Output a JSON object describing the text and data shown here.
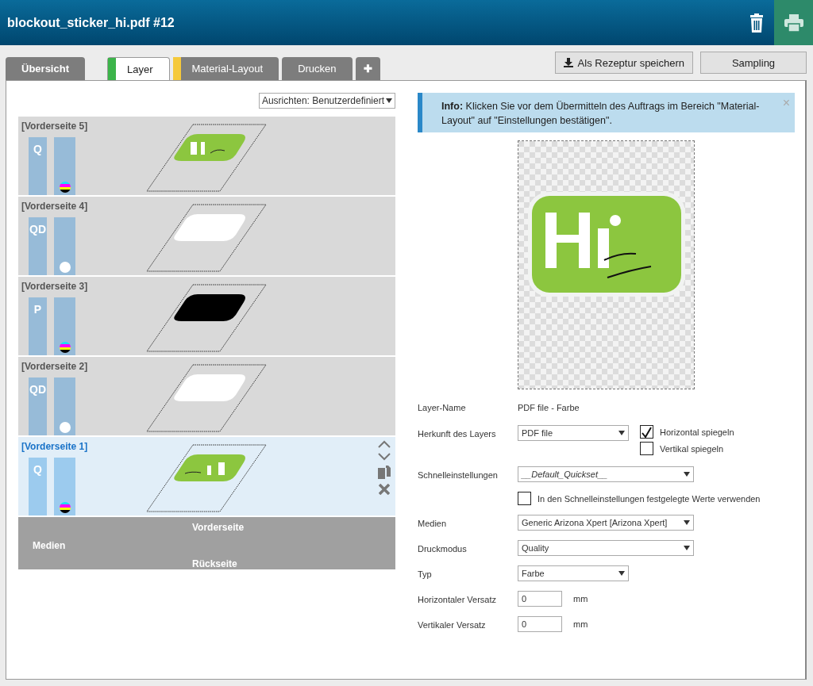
{
  "header": {
    "title": "blockout_sticker_hi.pdf #12"
  },
  "tabs": [
    {
      "label": "Übersicht",
      "selected": false
    },
    {
      "label": "Layer",
      "selected": true,
      "color": "#3cb44a"
    },
    {
      "label": "Material-Layout",
      "selected": false,
      "color": "#f5c93b"
    },
    {
      "label": "Drucken",
      "selected": false
    },
    {
      "label": "✚",
      "selected": false
    }
  ],
  "actions": [
    "Als Rezeptur speichern",
    "Sampling"
  ],
  "align_select": {
    "value": "Ausrichten: Benutzerdefiniert"
  },
  "layers": [
    {
      "label": "[Vorderseite 5]",
      "mode": "Q",
      "white_ink": false,
      "kind": "logo",
      "color": "#8cc63f",
      "mirrored": false,
      "selected": false
    },
    {
      "label": "[Vorderseite 4]",
      "mode": "QD",
      "white_ink": true,
      "kind": "shape",
      "color": "#ffffff",
      "selected": false
    },
    {
      "label": "[Vorderseite 3]",
      "mode": "P",
      "white_ink": false,
      "kind": "shape",
      "color": "#000000",
      "selected": false
    },
    {
      "label": "[Vorderseite 2]",
      "mode": "QD",
      "white_ink": true,
      "kind": "shape",
      "color": "#ffffff",
      "selected": false
    },
    {
      "label": "[Vorderseite 1]",
      "mode": "Q",
      "white_ink": false,
      "kind": "logo",
      "color": "#8cc63f",
      "mirrored": true,
      "selected": true
    }
  ],
  "media_footer": {
    "label": "Medien",
    "front": "Vorderseite",
    "back": "Rückseite"
  },
  "info": {
    "text": "**Info:** Klicken Sie vor dem Übermitteln des Auftrags im Bereich \"Material-Layout\" auf \"Einstellungen bestätigen\".",
    "close": "×"
  },
  "form": [
    {
      "kind": "text",
      "label": "Layer-Name",
      "value": "PDF file - Farbe"
    },
    {
      "kind": "select",
      "label": "Herkunft des Layers",
      "value": "PDF file",
      "options": [
        {
          "label": "Horizontal spiegeln",
          "checked": true
        },
        {
          "label": "Vertikal spiegeln",
          "checked": false
        }
      ]
    },
    {
      "kind": "quickset",
      "label": "Schnelleinstellungen",
      "value": "__Default_Quickset__"
    },
    {
      "kind": "checkbox",
      "label": "In den Schnelleinstellungen festgelegte Werte verwenden",
      "checked": false
    },
    {
      "kind": "select",
      "label": "Medien",
      "value": "Generic Arizona Xpert [Arizona Xpert]"
    },
    {
      "kind": "select",
      "label": "Druckmodus",
      "value": "Quality"
    },
    {
      "kind": "select",
      "label": "Typ",
      "value": "Farbe"
    },
    {
      "kind": "number",
      "label": "Horizontaler Versatz",
      "value": "0",
      "unit": "mm"
    },
    {
      "kind": "number",
      "label": "Vertikaler Versatz",
      "value": "0",
      "unit": "mm"
    }
  ]
}
